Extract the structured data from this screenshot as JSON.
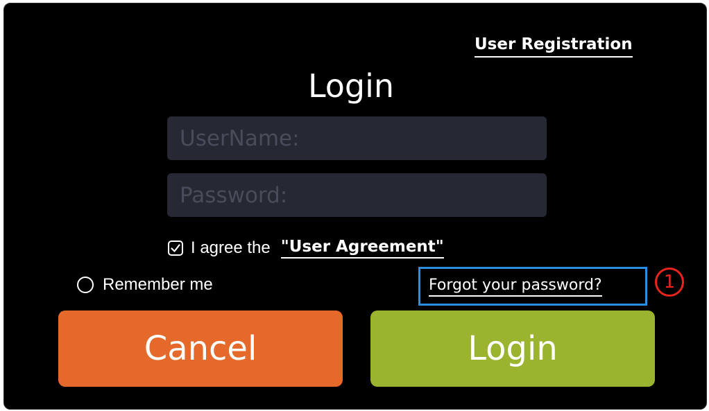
{
  "dialog": {
    "registration_link": "User Registration",
    "title": "Login",
    "username_placeholder": "UserName:",
    "password_placeholder": "Password:",
    "agree_text": "I agree the",
    "agree_link": "\"User Agreement\"",
    "agree_checked": true,
    "remember_text": "Remember me",
    "remember_checked": false,
    "forgot_link": "Forgot your password?",
    "annotation_marker": "1",
    "cancel_label": "Cancel",
    "login_label": "Login"
  },
  "colors": {
    "background": "#000000",
    "input_bg": "#262833",
    "placeholder": "#494c5a",
    "cancel_button": "#e5692a",
    "login_button": "#9bb42f",
    "highlight_box": "#2a8fe0",
    "marker": "#e8241c"
  },
  "icons": {
    "agree_checkbox": "checkbox-checked-icon",
    "remember_radio": "radio-empty-icon"
  }
}
